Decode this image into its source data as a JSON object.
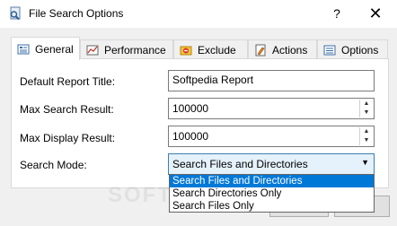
{
  "window": {
    "title": "File Search Options",
    "help_glyph": "?",
    "close_glyph": "✕"
  },
  "tabs": [
    {
      "label": "General",
      "icon": "general-icon",
      "active": true
    },
    {
      "label": "Performance",
      "icon": "performance-icon",
      "active": false
    },
    {
      "label": "Exclude",
      "icon": "exclude-icon",
      "active": false
    },
    {
      "label": "Actions",
      "icon": "actions-icon",
      "active": false
    },
    {
      "label": "Options",
      "icon": "options-icon",
      "active": false
    }
  ],
  "general": {
    "report_title_label": "Default Report Title:",
    "report_title_value": "Softpedia Report",
    "max_search_label": "Max Search Result:",
    "max_search_value": "100000",
    "max_display_label": "Max Display Result:",
    "max_display_value": "100000",
    "search_mode_label": "Search Mode:",
    "search_mode_value": "Search Files and Directories",
    "search_mode_options": [
      "Search Files and Directories",
      "Search Directories Only",
      "Search Files Only"
    ]
  },
  "watermark": "SOFT",
  "colors": {
    "accent": "#0078d7",
    "panel_border": "#d9d9d9",
    "combo_focus": "#e5f1fb"
  }
}
